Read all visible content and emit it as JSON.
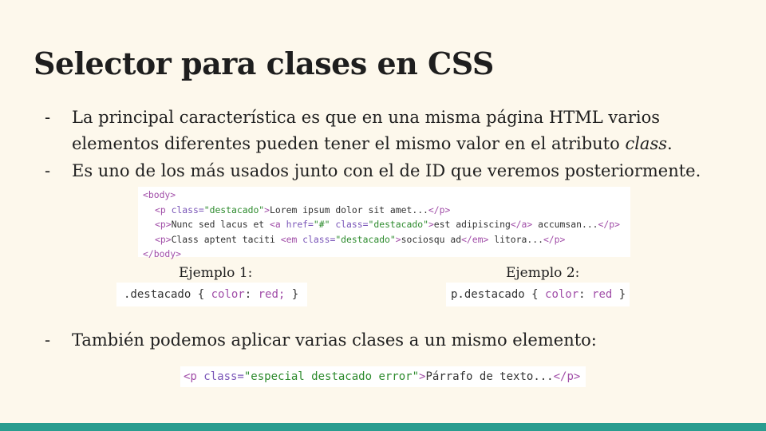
{
  "title": "Selector para clases en CSS",
  "bullets": [
    {
      "dash": "-",
      "text_before": "La principal característica es que en una misma página HTML varios elementos diferentes pueden tener el mismo valor en el atributo ",
      "text_em": "class",
      "text_after": "."
    },
    {
      "dash": "-",
      "text": "Es uno de los más usados junto con el de ID que veremos posteriormente."
    },
    {
      "dash": "-",
      "text": "También podemos aplicar varias clases a un mismo elemento:"
    }
  ],
  "code_main": {
    "l1_open": "<body>",
    "l2_tag_open": "<p",
    "l2_attr": " class=",
    "l2_str": "\"destacado\"",
    "l2_close": ">",
    "l2_text": "Lorem ipsum dolor sit amet...",
    "l2_end": "</p>",
    "l3_tag_open": "<p>",
    "l3_text1": "Nunc sed lacus et ",
    "l3_a_open": "<a",
    "l3_attr1": " href=",
    "l3_str1": "\"#\"",
    "l3_attr2": " class=",
    "l3_str2": "\"destacado\"",
    "l3_a_close": ">",
    "l3_text2": "est adipiscing",
    "l3_a_end": "</a>",
    "l3_text3": " accumsan...",
    "l3_end": "</p>",
    "l4_tag_open": "<p>",
    "l4_text1": "Class aptent taciti ",
    "l4_em_open": "<em",
    "l4_attr": " class=",
    "l4_str": "\"destacado\"",
    "l4_em_close": ">",
    "l4_text2": "sociosqu ad",
    "l4_em_end": "</em>",
    "l4_text3": " litora...",
    "l4_end": "</p>",
    "l5_close": "</body>"
  },
  "example1": {
    "label": "Ejemplo 1:",
    "selector": ".destacado { ",
    "prop": "color",
    "sep": ": ",
    "value": "red;",
    "end": " }"
  },
  "example2": {
    "label": "Ejemplo 2:",
    "selector": "p.destacado { ",
    "prop": "color",
    "sep": ": ",
    "value": "red",
    "end": " }"
  },
  "code_multi": {
    "tag_open": "<p",
    "attr": " class=",
    "str": "\"especial destacado error\"",
    "close": ">",
    "text": "Párrafo de texto...",
    "end": "</p>"
  },
  "colors": {
    "background": "#fdf8ec",
    "footer_bar": "#2a9d8f",
    "code_tag": "#a14ea8",
    "code_string": "#2e8b2e"
  }
}
